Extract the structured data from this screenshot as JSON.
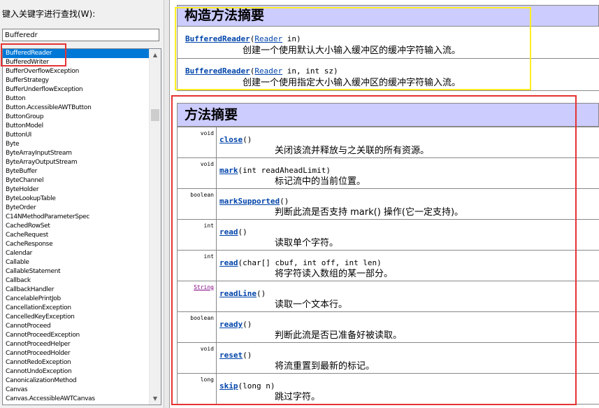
{
  "search": {
    "label": "键入关键字进行查找(W):",
    "value": "Bufferedr"
  },
  "classList": {
    "selected_index": 0,
    "items": [
      "BufferedReader",
      "BufferedWriter",
      "BufferOverflowException",
      "BufferStrategy",
      "BufferUnderflowException",
      "Button",
      "Button.AccessibleAWTButton",
      "ButtonGroup",
      "ButtonModel",
      "ButtonUI",
      "Byte",
      "ByteArrayInputStream",
      "ByteArrayOutputStream",
      "ByteBuffer",
      "ByteChannel",
      "ByteHolder",
      "ByteLookupTable",
      "ByteOrder",
      "C14NMethodParameterSpec",
      "CachedRowSet",
      "CacheRequest",
      "CacheResponse",
      "Calendar",
      "Callable",
      "CallableStatement",
      "Callback",
      "CallbackHandler",
      "CancelablePrintJob",
      "CancellationException",
      "CancelledKeyException",
      "CannotProceed",
      "CannotProceedException",
      "CannotProceedHelper",
      "CannotProceedHolder",
      "CannotRedoException",
      "CannotUndoException",
      "CanonicalizationMethod",
      "Canvas",
      "Canvas.AccessibleAWTCanvas"
    ],
    "scroll_up_icon": "▲",
    "scroll_down_icon": "▼"
  },
  "constructors": {
    "heading": "构造方法摘要",
    "rows": [
      {
        "name": "BufferedReader",
        "open": "(",
        "param_type": "Reader",
        "params_rest": " in)",
        "desc": "创建一个使用默认大小输入缓冲区的缓冲字符输入流。"
      },
      {
        "name": "BufferedReader",
        "open": "(",
        "param_type": "Reader",
        "params_rest": " in, int sz)",
        "desc": "创建一个使用指定大小输入缓冲区的缓冲字符输入流。"
      }
    ]
  },
  "methods": {
    "heading": "方法摘要",
    "rows": [
      {
        "ret": "void",
        "name": "close",
        "params": "()",
        "desc": "关闭该流并释放与之关联的所有资源。"
      },
      {
        "ret": "void",
        "name": "mark",
        "params": "(int readAheadLimit)",
        "desc": "标记流中的当前位置。"
      },
      {
        "ret": "boolean",
        "name": "markSupported",
        "params": "()",
        "desc": "判断此流是否支持 mark() 操作(它一定支持)。"
      },
      {
        "ret": "int",
        "name": "read",
        "params": "()",
        "desc": "读取单个字符。"
      },
      {
        "ret": "int",
        "name": "read",
        "params": "(char[] cbuf, int off, int len)",
        "desc": "将字符读入数组的某一部分。"
      },
      {
        "ret": "String",
        "name": "readLine",
        "params": "()",
        "desc": "读取一个文本行。"
      },
      {
        "ret": "boolean",
        "name": "ready",
        "params": "()",
        "desc": "判断此流是否已准备好被读取。"
      },
      {
        "ret": "void",
        "name": "reset",
        "params": "()",
        "desc": "将流重置到最新的标记。"
      },
      {
        "ret": "long",
        "name": "skip",
        "params": "(long n)",
        "desc": "跳过字符。"
      }
    ]
  },
  "colors": {
    "selection": "#0078d7",
    "section_header": "#ccccff",
    "link": "#0044aa",
    "annotation_red": "#e53333",
    "annotation_yellow": "#ffee22"
  }
}
